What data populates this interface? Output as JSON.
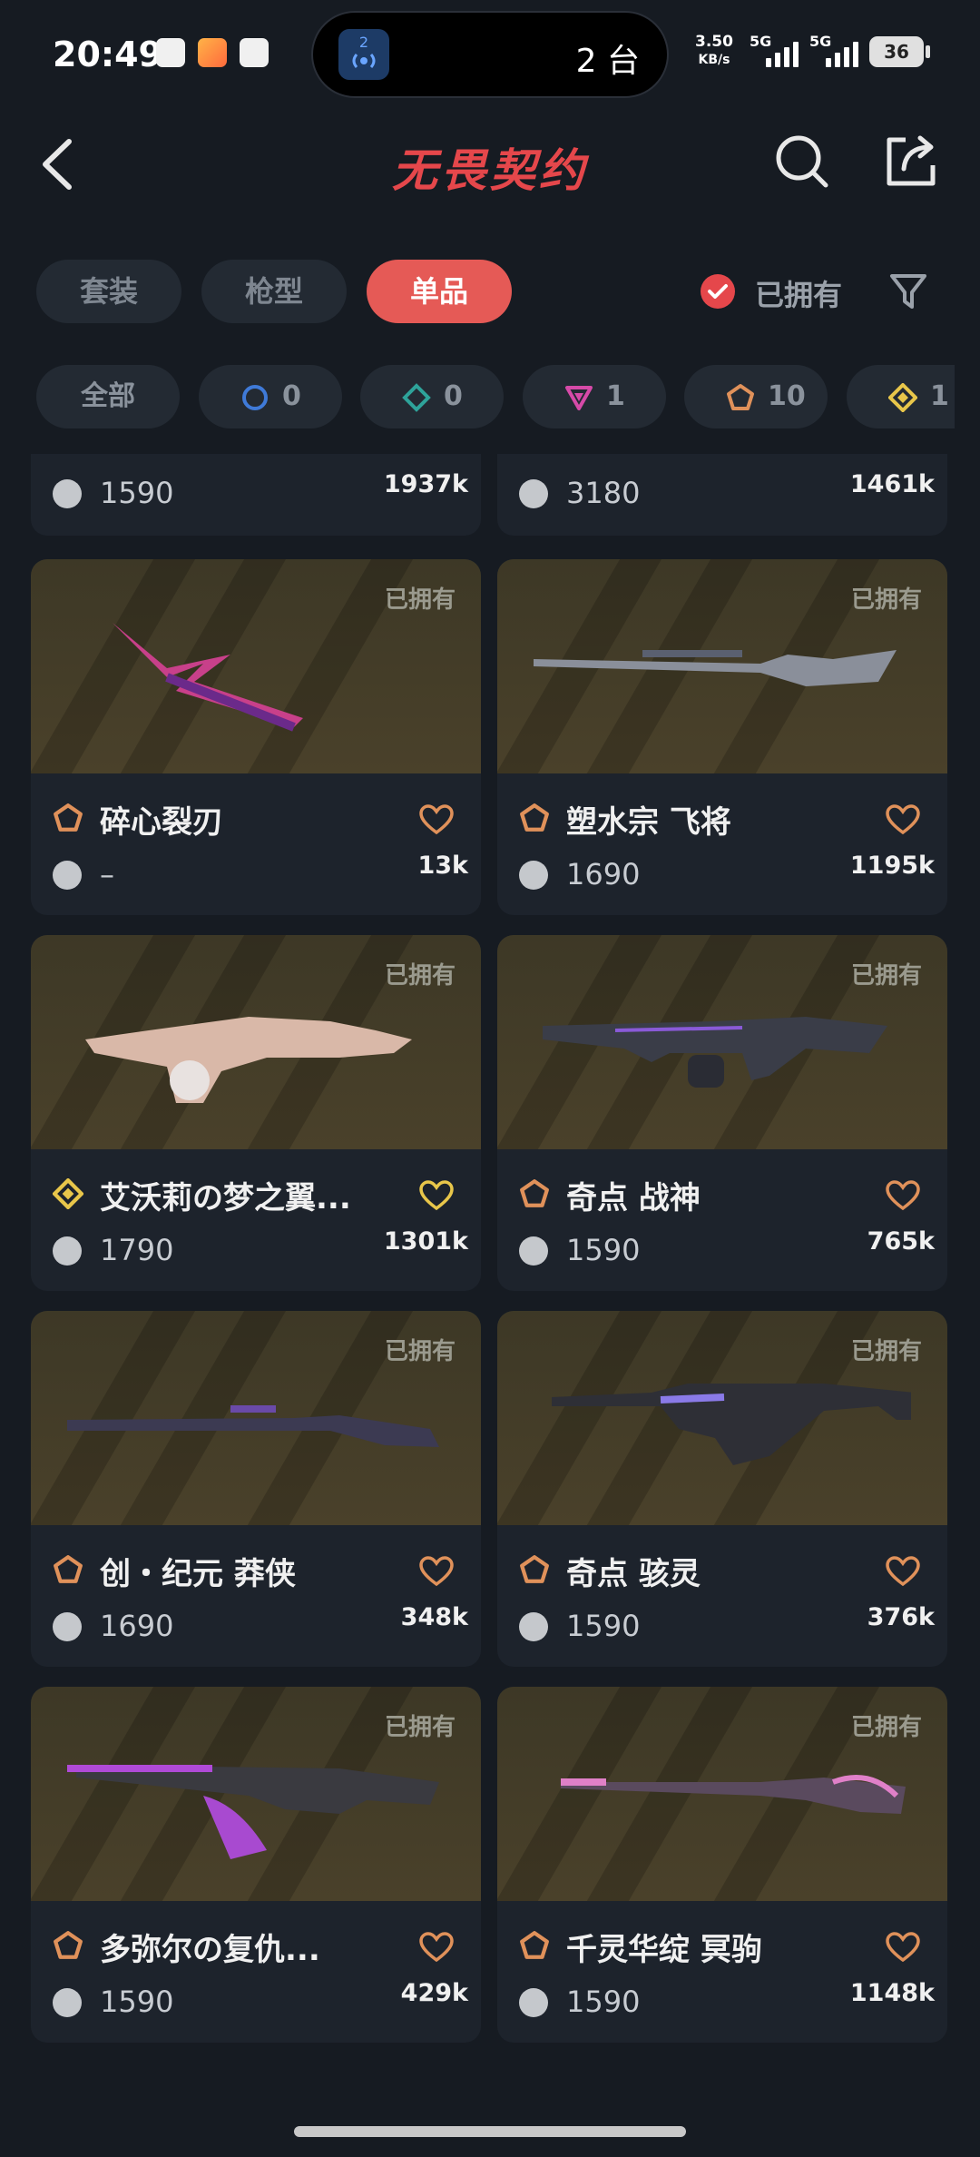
{
  "status_bar": {
    "time": "20:49",
    "island_count": "2",
    "island_text": "2 台",
    "net_speed": "3.50",
    "net_unit": "KB/s",
    "sim1": "5G",
    "sim2": "5G",
    "battery": "36"
  },
  "header": {
    "title": "无畏契约"
  },
  "category_tabs": [
    "套装",
    "枪型",
    "单品"
  ],
  "owned_filter_label": "已拥有",
  "rarity_chips": {
    "all": "全部",
    "select": "0",
    "deluxe": "0",
    "premium": "1",
    "exclusive": "10",
    "ultra": "1"
  },
  "owned_badge": "已拥有",
  "cards": [
    {
      "name": "",
      "price": "1590",
      "likes": "1937k",
      "rarity": "exclusive"
    },
    {
      "name": "",
      "price": "3180",
      "likes": "1461k",
      "rarity": "exclusive"
    },
    {
      "name": "碎心裂刃",
      "price": "–",
      "likes": "13k",
      "rarity": "exclusive"
    },
    {
      "name": "塑水宗 飞将",
      "price": "1690",
      "likes": "1195k",
      "rarity": "exclusive"
    },
    {
      "name": "艾沃莉の梦之翼...",
      "price": "1790",
      "likes": "1301k",
      "rarity": "ultra"
    },
    {
      "name": "奇点 战神",
      "price": "1590",
      "likes": "765k",
      "rarity": "exclusive"
    },
    {
      "name": "创・纪元 莽侠",
      "price": "1690",
      "likes": "348k",
      "rarity": "exclusive"
    },
    {
      "name": "奇点 骇灵",
      "price": "1590",
      "likes": "376k",
      "rarity": "exclusive"
    },
    {
      "name": "多弥尔の复仇...",
      "price": "1590",
      "likes": "429k",
      "rarity": "exclusive"
    },
    {
      "name": "千灵华绽 冥驹",
      "price": "1590",
      "likes": "1148k",
      "rarity": "exclusive"
    }
  ],
  "colors": {
    "background": "#161b22",
    "accent": "#e5474b",
    "exclusive": "#e0915a",
    "ultra": "#e8c64a",
    "premium": "#d64aa8",
    "select": "#3f7ad8",
    "deluxe": "#2ea39a"
  }
}
